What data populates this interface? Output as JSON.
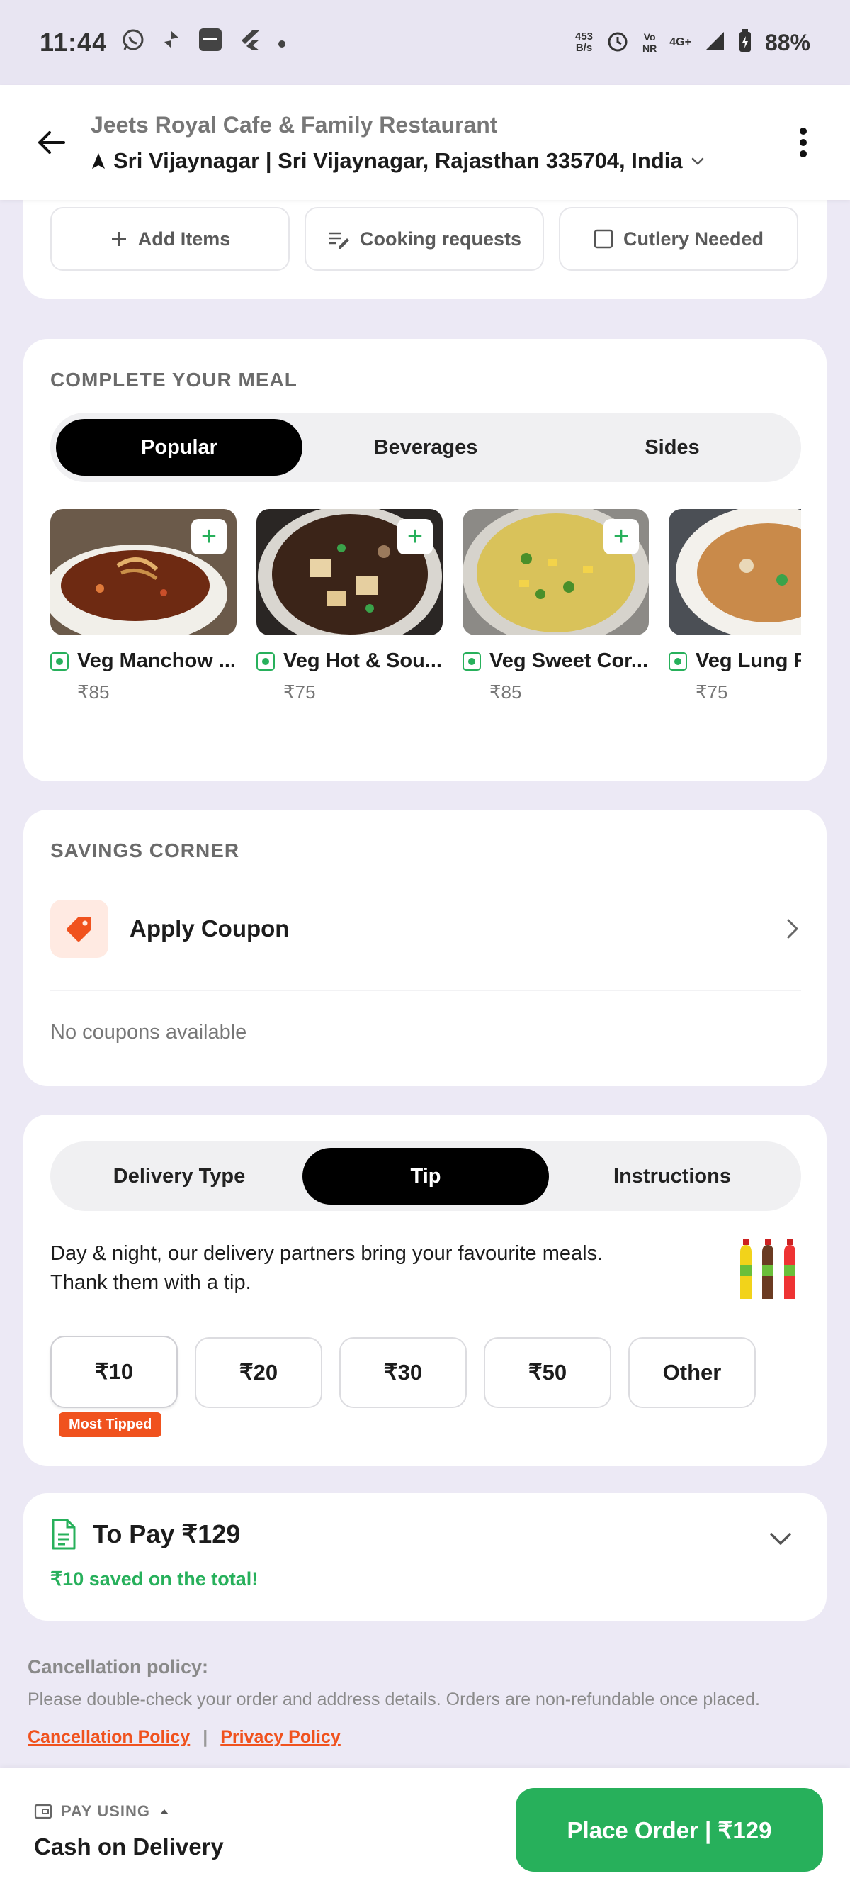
{
  "status_bar": {
    "time": "11:44",
    "net_speed_value": "453",
    "net_speed_unit": "B/s",
    "volte_label": "Vo\nNR",
    "network": "4G+",
    "battery": "88%",
    "icons": [
      "whatsapp-icon",
      "sync-icon",
      "paytm-icon",
      "flutter-icon",
      "dot-icon",
      "alarm-icon",
      "signal-icon",
      "battery-icon"
    ]
  },
  "header": {
    "restaurant_name": "Jeets Royal Cafe & Family Restaurant",
    "address": "Sri Vijaynagar | Sri Vijaynagar, Rajasthan 335704, India"
  },
  "actions": {
    "add_items": "Add Items",
    "cooking_requests": "Cooking requests",
    "cutlery": "Cutlery Needed"
  },
  "meal": {
    "title": "COMPLETE YOUR MEAL",
    "tabs": [
      "Popular",
      "Beverages",
      "Sides"
    ],
    "active_tab": "Popular",
    "items": [
      {
        "name": "Veg Manchow ...",
        "price": "₹85"
      },
      {
        "name": "Veg Hot & Sou...",
        "price": "₹75"
      },
      {
        "name": "Veg Sweet Cor...",
        "price": "₹85"
      },
      {
        "name": "Veg Lung F",
        "price": "₹75"
      }
    ]
  },
  "savings": {
    "title": "SAVINGS CORNER",
    "apply_coupon": "Apply Coupon",
    "no_coupons": "No coupons available"
  },
  "tip": {
    "tabs": [
      "Delivery Type",
      "Tip",
      "Instructions"
    ],
    "active_tab": "Tip",
    "message_line1": "Day & night, our delivery partners bring your favourite meals.",
    "message_line2": "Thank them with a tip.",
    "options": [
      "₹10",
      "₹20",
      "₹30",
      "₹50",
      "Other"
    ],
    "badge": "Most Tipped"
  },
  "to_pay": {
    "label": "To Pay ₹129",
    "saved": "₹10 saved on the total!"
  },
  "policy": {
    "title": "Cancellation policy:",
    "text": "Please double-check your order and address details. Orders are non-refundable once placed.",
    "link_cancellation": "Cancellation Policy",
    "separator": "|",
    "link_privacy": "Privacy Policy"
  },
  "bottom": {
    "pay_using": "PAY USING",
    "method": "Cash on Delivery",
    "place_order": "Place Order | ₹129"
  },
  "colors": {
    "green": "#27B05B",
    "orange": "#F0521E",
    "background": "#ECE9F5"
  }
}
